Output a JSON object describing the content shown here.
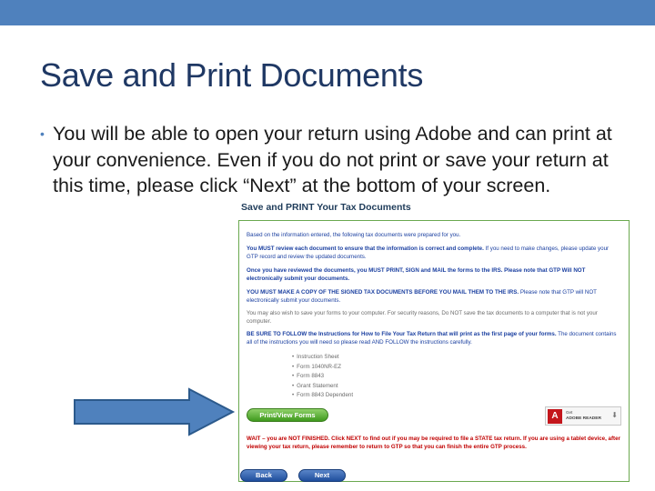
{
  "slide": {
    "title": "Save and Print Documents",
    "bullet": "You will be able to open your return using Adobe and can print at your convenience. Even if you do not print or save your return at this time, please click “Next” at the bottom of your screen."
  },
  "screenshot": {
    "heading": "Save and PRINT Your Tax Documents",
    "para1": "Based on the information entered, the following tax documents were prepared for you.",
    "para2_bold": "You MUST review each document to ensure that the information is correct and complete.",
    "para2_rest": " If you need to make changes, please update your GTP record and review the updated documents.",
    "para3_bold": "Once you have reviewed the documents, you MUST PRINT, SIGN and MAIL the forms to the IRS. Please note that GTP Will NOT electronically submit your documents.",
    "para4_bold": "YOU MUST MAKE A COPY OF THE SIGNED TAX DOCUMENTS BEFORE YOU MAIL THEM TO THE IRS.",
    "para4_rest": " Please note that GTP will NOT electronically submit your documents.",
    "para5": "You may also wish to save your forms to your computer. For security reasons, Do NOT save the tax documents to a computer that is not your computer.",
    "para6_bold": "BE SURE TO FOLLOW the Instructions for How to File Your Tax Return that will print as the first page of your forms.",
    "para6_rest": " The document contains all of the instructions you will need so please read AND FOLLOW the instructions carefully.",
    "documents": [
      "Instruction Sheet",
      "Form 1040NR-EZ",
      "Form 8843",
      "Grant Statement",
      "Form 8843 Dependent"
    ],
    "print_button": "Print/View Forms",
    "adobe_line1": "Get",
    "adobe_line2": "ADOBE READER",
    "adobe_icon_letter": "A",
    "warning": "WAIT – you are NOT FINISHED. Click NEXT to find out if you may be required to file a STATE tax return. If you are using a tablet device, after viewing your tax return, please remember to return to GTP so that you can finish the entire GTP process.",
    "back_button": "Back",
    "next_button": "Next"
  },
  "colors": {
    "top_bar": "#4f81bd",
    "title": "#1f3864",
    "arrow_fill": "#4f81bd",
    "arrow_stroke": "#2c5a8c",
    "instruction_text": "#1a3fa0",
    "warning_text": "#c00000",
    "print_button": "#3f9a1e",
    "nav_button": "#1f4e9c"
  }
}
